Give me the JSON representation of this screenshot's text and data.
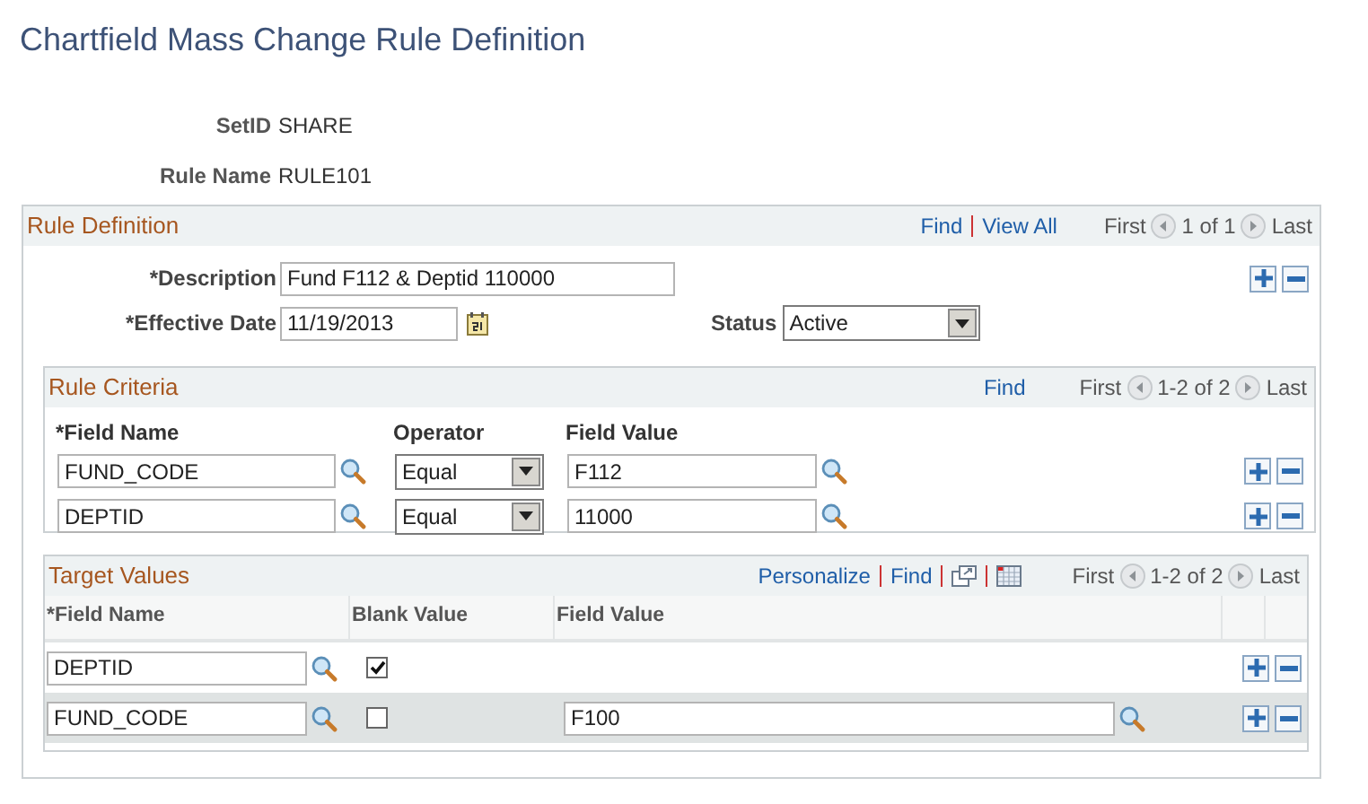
{
  "page_title": "Chartfield Mass Change Rule Definition",
  "header_fields": [
    {
      "label": "SetID",
      "value": "SHARE"
    },
    {
      "label": "Rule Name",
      "value": "RULE101"
    }
  ],
  "rule_definition": {
    "title": "Rule Definition",
    "nav_links": [
      "Find",
      "View All"
    ],
    "pager": {
      "first": "First",
      "range": "1 of 1",
      "last": "Last"
    },
    "description": {
      "label": "*Description",
      "value": "Fund F112 & Deptid 110000"
    },
    "effective_date": {
      "label": "*Effective Date",
      "value": "11/19/2013"
    },
    "status": {
      "label": "Status",
      "value": "Active"
    }
  },
  "rule_criteria": {
    "title": "Rule Criteria",
    "nav_links": [
      "Find"
    ],
    "pager": {
      "first": "First",
      "range": "1-2 of 2",
      "last": "Last"
    },
    "columns": [
      "*Field Name",
      "Operator",
      "Field Value"
    ],
    "rows": [
      {
        "field_name": "FUND_CODE",
        "operator": "Equal",
        "field_value": "F112"
      },
      {
        "field_name": "DEPTID",
        "operator": "Equal",
        "field_value": "11000"
      }
    ]
  },
  "target_values": {
    "title": "Target Values",
    "nav_links": [
      "Personalize",
      "Find"
    ],
    "pager": {
      "first": "First",
      "range": "1-2 of 2",
      "last": "Last"
    },
    "columns": [
      "*Field Name",
      "Blank Value",
      "Field Value"
    ],
    "rows": [
      {
        "field_name": "DEPTID",
        "blank_value": true
      },
      {
        "field_name": "FUND_CODE",
        "blank_value": false,
        "field_value": "F100"
      }
    ]
  }
}
